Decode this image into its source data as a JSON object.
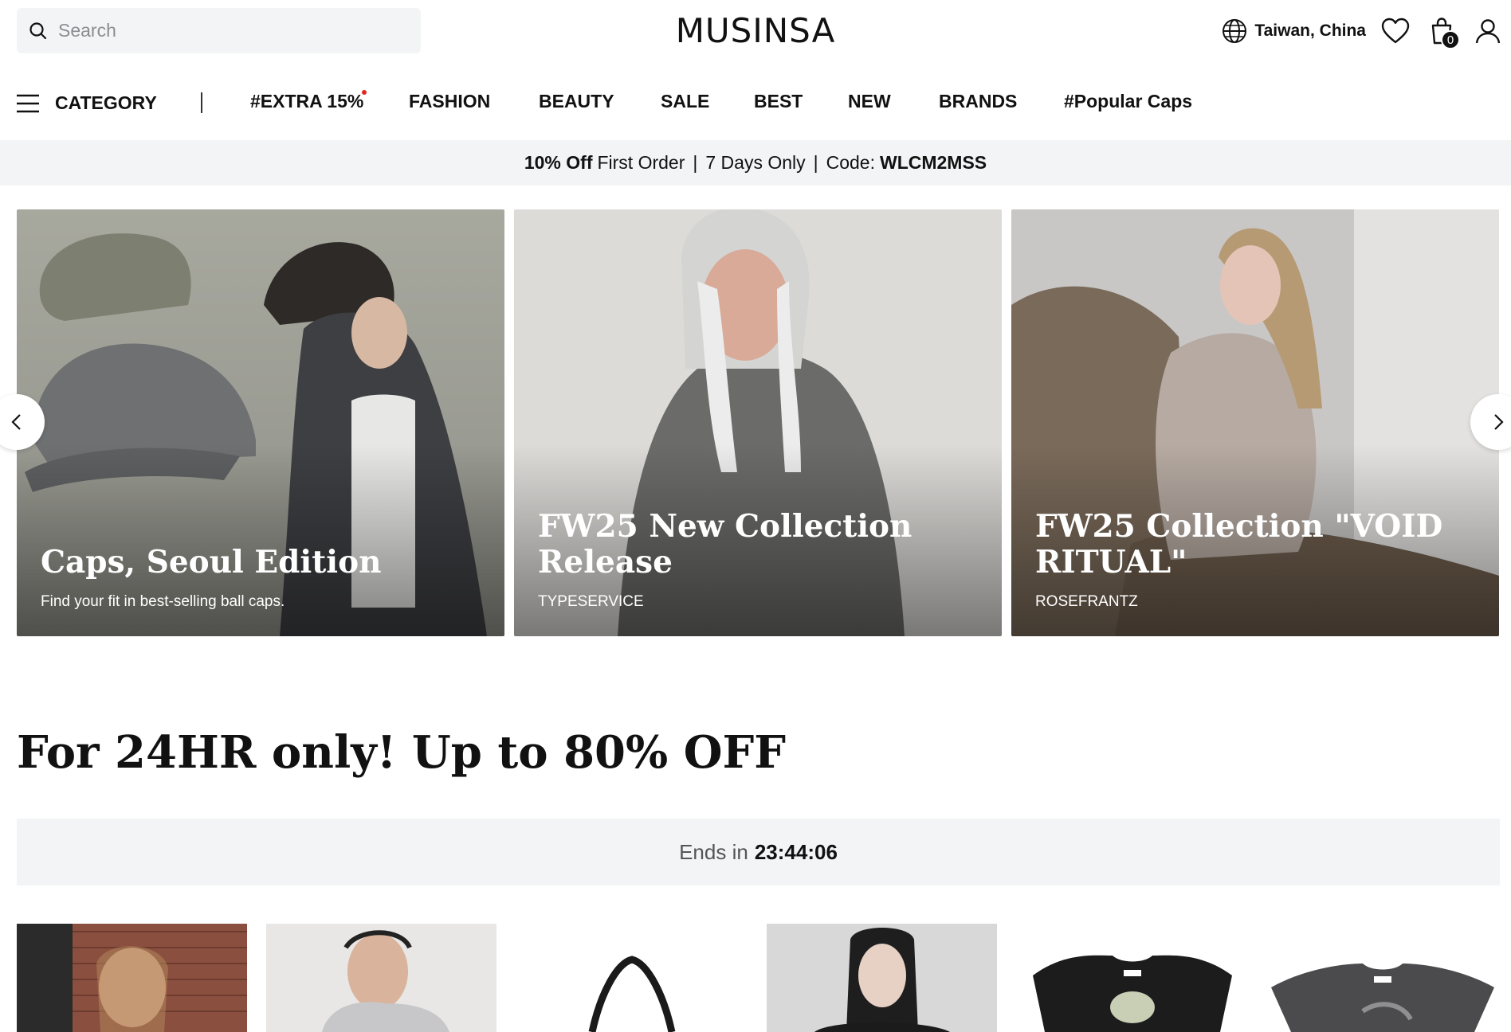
{
  "header": {
    "search_placeholder": "Search",
    "logo": "MUSINSA",
    "region": "Taiwan, China",
    "cart_count": "0"
  },
  "nav": {
    "category_label": "CATEGORY",
    "items": [
      {
        "label": "#EXTRA 15%",
        "has_dot": true
      },
      {
        "label": "FASHION"
      },
      {
        "label": "BEAUTY"
      },
      {
        "label": "SALE"
      },
      {
        "label": "BEST"
      },
      {
        "label": "NEW"
      },
      {
        "label": "BRANDS"
      },
      {
        "label": "#Popular Caps"
      }
    ]
  },
  "promo": {
    "discount": "10% Off",
    "first_order": "First Order",
    "duration": "7 Days Only",
    "code_label": "Code:",
    "code": "WLCM2MSS"
  },
  "banners": [
    {
      "title": "Caps, Seoul Edition",
      "subtitle": "Find your fit in best-selling ball caps."
    },
    {
      "title": "FW25 New Collection Release",
      "subtitle": "TYPESERVICE"
    },
    {
      "title": "FW25 Collection \"VOID RITUAL\"",
      "subtitle": "ROSEFRANTZ"
    }
  ],
  "deal": {
    "title": "For 24HR only! Up to 80% OFF",
    "ends_label": "Ends in",
    "countdown": "23:44:06"
  },
  "colors": {
    "accent_dot": "#e0261f",
    "panel_bg": "#f3f4f5",
    "text": "#111111"
  },
  "icons": [
    "search-icon",
    "globe-icon",
    "heart-icon",
    "bag-icon",
    "user-icon",
    "hamburger-icon",
    "chevron-left-icon",
    "chevron-right-icon"
  ]
}
